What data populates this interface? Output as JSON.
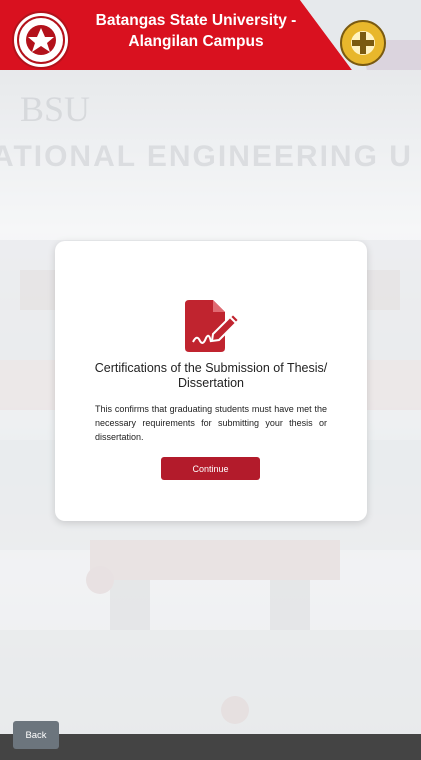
{
  "header": {
    "title_line1": "Batangas State University -",
    "title_line2": "Alangilan Campus",
    "left_logo_icon": "university-seal-icon",
    "right_logo_icon": "engineering-seal-icon",
    "brand_color": "#d9111f"
  },
  "card": {
    "icon": "signed-document-icon",
    "title_line1": "Certifications of the Submission of Thesis/",
    "title_line2": "Dissertation",
    "description": "This confirms that graduating students must have met the necessary requirements for submitting your thesis or dissertation.",
    "continue_label": "Continue",
    "accent_color": "#b31b2b"
  },
  "carousel": {
    "prev_icon": "chevron-left-icon",
    "next_icon": "chevron-right-icon"
  },
  "footer": {
    "back_label": "Back"
  }
}
